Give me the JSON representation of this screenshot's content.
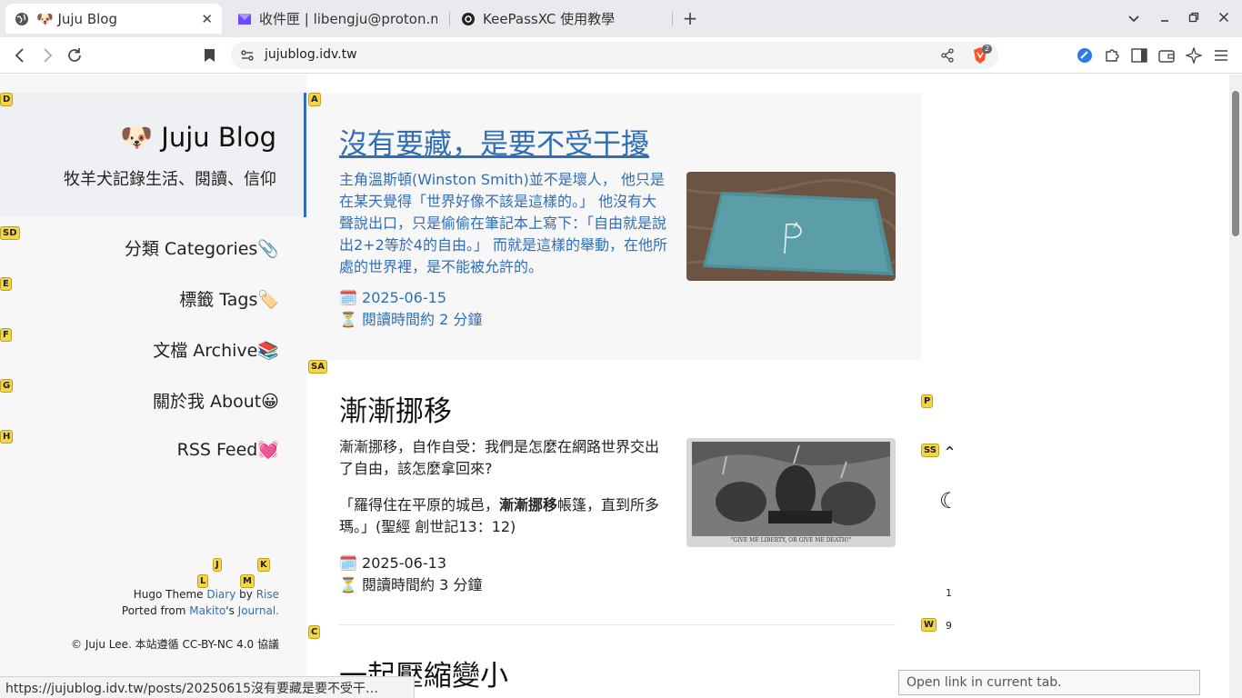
{
  "browser": {
    "tabs": [
      {
        "title": "🐶 Juju Blog",
        "icon": "globe-icon",
        "active": true
      },
      {
        "title": "收件匣 | libengju@proton.m",
        "icon": "proton-mail-icon",
        "active": false
      },
      {
        "title": "KeePassXC 使用教學",
        "icon": "keepassxc-icon",
        "active": false
      }
    ],
    "tab_close": "✕",
    "new_tab": "+",
    "url": "jujublog.idv.tw",
    "shield_count": "2",
    "status_url": "https://jujublog.idv.tw/posts/20250615沒有要藏是要不受干…",
    "tooltip": "Open link in current tab."
  },
  "site": {
    "title": "🐶 Juju Blog",
    "subtitle": "牧羊犬記錄生活、閱讀、信仰",
    "nav": [
      {
        "label": "分類 Categories📎"
      },
      {
        "label": "標籤 Tags🏷️"
      },
      {
        "label": "文檔 Archive📚"
      },
      {
        "label": "關於我 About😀"
      },
      {
        "label": "RSS Feed💓"
      }
    ],
    "footer": {
      "theme_prefix": "Hugo Theme ",
      "theme_name": "Diary",
      "by": " by ",
      "author": "Rise",
      "ported_prefix": "Ported from ",
      "ported_author": "Makito",
      "possessive": "'s ",
      "ported_theme": "Journal.",
      "copyright": "© Juju Lee. 本站遵循 CC-BY-NC 4.0 協議"
    }
  },
  "posts": [
    {
      "title": "沒有要藏，是要不受干擾",
      "excerpt": "主角溫斯頓(Winston Smith)並不是壞人， 他只是在某天覺得「世界好像不該是這樣的。」 他沒有大聲說出口，只是偷偷在筆記本上寫下：「自由就是說出2+2等於4的自由。」 而就是這樣的舉動，在他所處的世界裡，是不能被允許的。",
      "date": "🗓️ 2025-06-15",
      "reading": "⏳ 閱讀時間約 2 分鐘"
    },
    {
      "title": "漸漸挪移",
      "excerpt1": "漸漸挪移，自作自受：我們是怎麼在網路世界交出了自由，該怎麼拿回來?",
      "quote_pre": "「羅得住在平原的城邑，",
      "quote_bold": "漸漸挪移",
      "quote_post": "帳篷，直到所多瑪。」(聖經 創世記13：12)",
      "date": "🗓️ 2025-06-13",
      "reading": "⏳ 閱讀時間約 3 分鐘",
      "image_caption": "\"GIVE ME LIBERTY, OR GIVE ME DEATH!\""
    },
    {
      "title": "一起壓縮變小"
    }
  ],
  "rightcol": {
    "toc_numbers": [
      "1",
      "9"
    ],
    "scroll_up": "⌃",
    "theme_toggle": "☾"
  },
  "hints": [
    "D",
    "A",
    "SD",
    "E",
    "F",
    "G",
    "H",
    "SA",
    "P",
    "SS",
    "J",
    "K",
    "L",
    "M",
    "C",
    "W"
  ]
}
